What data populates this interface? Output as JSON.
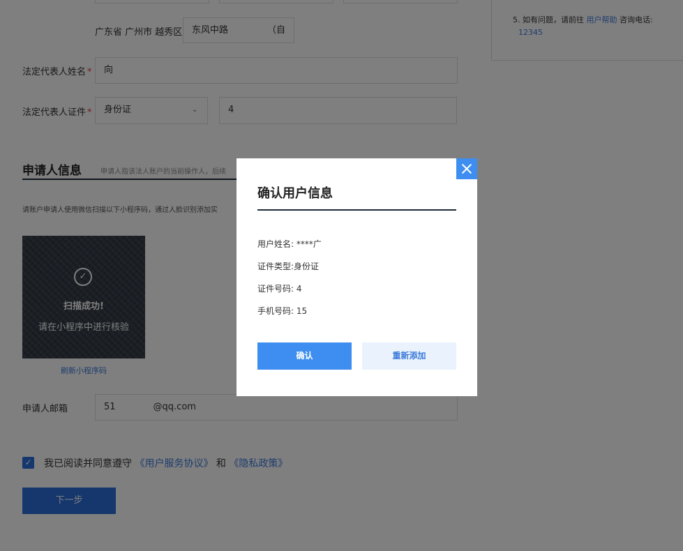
{
  "address": {
    "region": "广东省 广州市 越秀区",
    "street_value": "东风中路",
    "street_suffix": "（自"
  },
  "help": {
    "prefix": "5. 如有问题，请前往",
    "link": "用户帮助",
    "suffix": "咨询电话:",
    "phone": "12345"
  },
  "legal_rep": {
    "name_label": "法定代表人姓名",
    "name_value": "向",
    "id_label": "法定代表人证件",
    "id_type": "身份证",
    "id_value": "4"
  },
  "required_mark": "*",
  "applicant": {
    "title": "申请人信息",
    "subtitle": "申请人指该法人账户的当前操作人，后续",
    "instruction": "请账户申请人使用微信扫描以下小程序码，通过人脸识别添加实",
    "qr_success": "扫描成功!",
    "qr_hint": "请在小程序中进行核验",
    "refresh_link": "刷新小程序码",
    "email_label": "申请人邮箱",
    "email_prefix": "51",
    "email_suffix": "@qq.com"
  },
  "agreement": {
    "text": "我已阅读并同意遵守",
    "link1": "《用户服务协议》",
    "and": "和",
    "link2": "《隐私政策》"
  },
  "next_button": "下一步",
  "modal": {
    "title": "确认用户信息",
    "rows": [
      {
        "label": "用户姓名:",
        "value": "****广"
      },
      {
        "label": "证件类型:",
        "value": "身份证"
      },
      {
        "label": "证件号码:",
        "value": "4"
      },
      {
        "label": "手机号码:",
        "value": "15"
      }
    ],
    "confirm": "确认",
    "readd": "重新添加"
  },
  "colors": {
    "primary": "#2a6fdb",
    "modal_accent": "#3d8ef0",
    "link": "#3d7bd9",
    "required": "#e4393c"
  }
}
